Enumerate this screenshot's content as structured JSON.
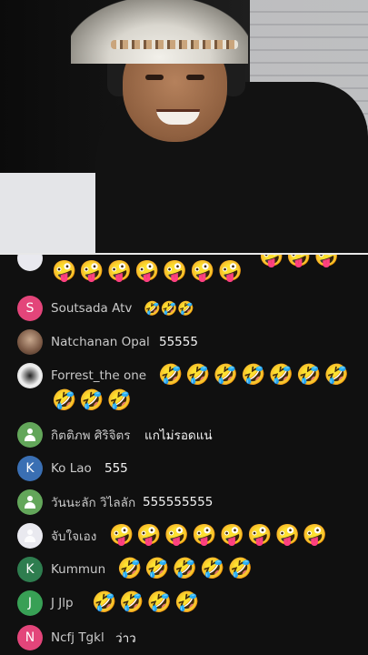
{
  "stream": {
    "description_icon": "video-feed"
  },
  "chat": {
    "top_partial_emojis": [
      "🤪",
      "🤪",
      "🤪",
      "🤪",
      "🤪",
      "🤪",
      "🤪"
    ],
    "top_partial_emojis_right": [
      "🤪",
      "🤪",
      "🤪"
    ],
    "messages": [
      {
        "name": "Soutsada Atv",
        "avatar_letter": "S",
        "avatar_color": "#e3457a",
        "text": "🤣🤣🤣"
      },
      {
        "name": "Natchanan Opal",
        "avatar_letter": "",
        "avatar_color": "#8a6a55",
        "text": "55555"
      },
      {
        "name": "Forrest_the one",
        "avatar_letter": "",
        "avatar_color": "#f0f0f0",
        "emoji_row1": [
          "🤣",
          "🤣",
          "🤣",
          "🤣",
          "🤣",
          "🤣",
          "🤣",
          "🤣"
        ],
        "emoji_row2": [
          "🤣",
          "🤣",
          "🤣"
        ]
      },
      {
        "name": "กิตติภพ ศิริจิตร",
        "avatar_letter": "",
        "avatar_color": "#63a65a",
        "text": "แกไม่รอดแน่"
      },
      {
        "name": "Ko Lao",
        "avatar_letter": "K",
        "avatar_color": "#3a6fb3",
        "text": "555"
      },
      {
        "name": "วันนะลัก วิไลลัก",
        "avatar_letter": "",
        "avatar_color": "#63a65a",
        "text": "555555555"
      },
      {
        "name": "จับใจเอง",
        "avatar_letter": "",
        "avatar_color": "#e9e9ef",
        "emojis": [
          "🤪",
          "🤪",
          "🤪",
          "🤪",
          "🤪",
          "🤪",
          "🤪",
          "🤪"
        ]
      },
      {
        "name": "Kummun",
        "avatar_letter": "K",
        "avatar_color": "#2e7d4f",
        "emojis": [
          "🤣",
          "🤣",
          "🤣",
          "🤣",
          "🤣"
        ]
      },
      {
        "name": "J Jlp",
        "avatar_letter": "J",
        "avatar_color": "#38a055",
        "emojis": [
          "🤣",
          "🤣",
          "🤣",
          "🤣"
        ]
      },
      {
        "name": "Ncfj Tgkl",
        "avatar_letter": "N",
        "avatar_color": "#e3457a",
        "text": "ว่าว"
      }
    ]
  }
}
